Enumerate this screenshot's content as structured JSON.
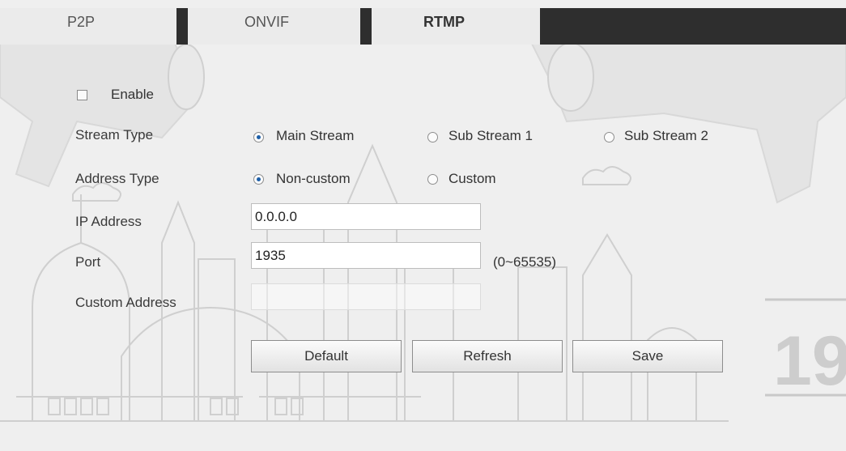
{
  "tabs": [
    {
      "label": "P2P",
      "active": false
    },
    {
      "label": "ONVIF",
      "active": false
    },
    {
      "label": "RTMP",
      "active": true
    }
  ],
  "enable": {
    "label": "Enable",
    "checked": false
  },
  "stream_type": {
    "label": "Stream Type",
    "options": [
      "Main Stream",
      "Sub Stream 1",
      "Sub Stream 2"
    ],
    "selected": "Main Stream"
  },
  "address_type": {
    "label": "Address Type",
    "options": [
      "Non-custom",
      "Custom"
    ],
    "selected": "Non-custom"
  },
  "ip_address": {
    "label": "IP Address",
    "value": "0.0.0.0"
  },
  "port": {
    "label": "Port",
    "value": "1935",
    "range_hint": "(0~65535)"
  },
  "custom_address": {
    "label": "Custom Address",
    "value": "",
    "disabled": true
  },
  "buttons": {
    "default": "Default",
    "refresh": "Refresh",
    "save": "Save"
  },
  "watermark": {
    "number": "19"
  },
  "colors": {
    "accent": "#1d5fa8",
    "tab_dark": "#2e2e2e",
    "background": "#efefef"
  }
}
